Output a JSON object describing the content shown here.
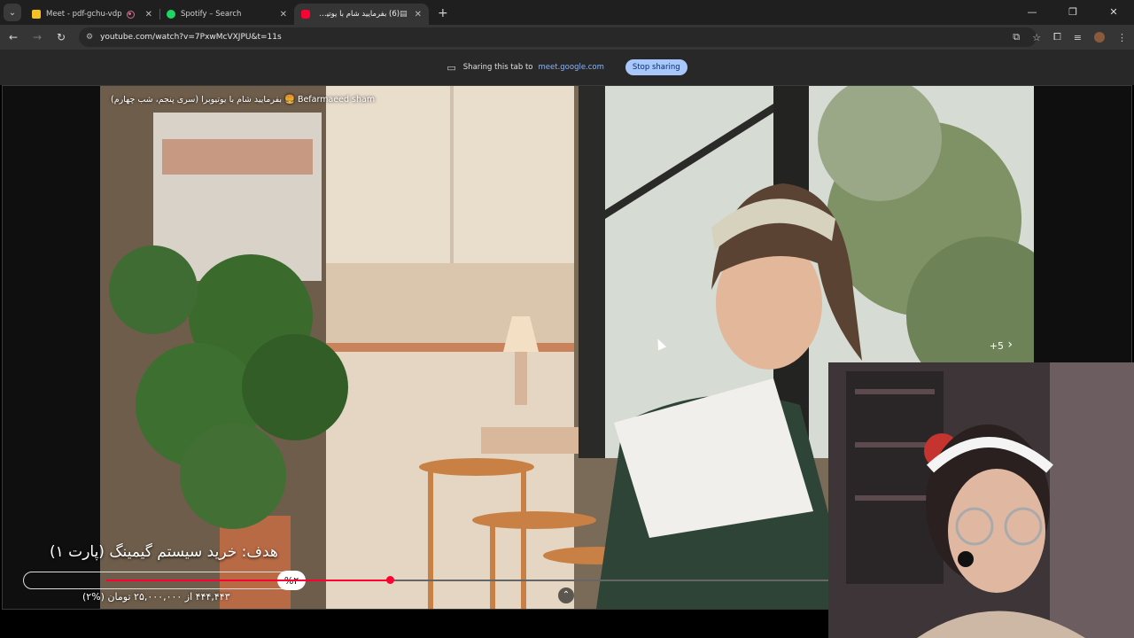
{
  "tabs": [
    {
      "title": "Meet - pdf-gchu-vdp",
      "favicon_color": "#f6c026",
      "recording": true
    },
    {
      "title": "Spotify – Search",
      "favicon_color": "#1ed760"
    },
    {
      "title": "(6) بفرمایید شام با یوتیوبرا (...",
      "favicon_color": "#ff0033",
      "active": true,
      "media_playing": true
    }
  ],
  "toolbar": {
    "url": "youtube.com/watch?v=7PxwMcVXJPU&t=11s"
  },
  "share_bar": {
    "text": "Sharing this tab to",
    "host": "meet.google.com",
    "stop_label": "Stop sharing"
  },
  "video": {
    "title": "بفرمایید شام با یوتیوبرا (سری پنجم، شب چهارم) 🍔 Befarmaeed sham",
    "photo_count": "+5",
    "progress_fraction": 0.42
  },
  "goal_overlay": {
    "label": "هدف: خرید سیستم گیمینگ (پارت ۱)",
    "percent_label": "%۲",
    "percent_value": 2,
    "amount_text": "۴۴۴,۴۴۳ از ۲۵,۰۰۰,۰۰۰ تومان (%۲)"
  },
  "colors": {
    "tabstrip": "#1f1f1f",
    "toolbar": "#353535",
    "share_bar": "#282828",
    "stop_button": "#a8c7fa",
    "accent_red": "#ff0033"
  }
}
